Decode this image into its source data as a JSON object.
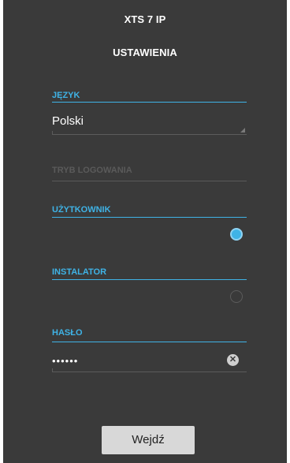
{
  "header": {
    "app_title": "XTS 7 IP",
    "page_title": "USTAWIENIA"
  },
  "language": {
    "label": "JĘZYK",
    "value": "Polski"
  },
  "login_mode": {
    "label": "TRYB LOGOWANIA"
  },
  "options": [
    {
      "label": "UŻYTKOWNIK",
      "selected": true
    },
    {
      "label": "INSTALATOR",
      "selected": false
    }
  ],
  "password": {
    "label": "HASŁO",
    "value": "••••••"
  },
  "submit": {
    "label": "Wejdź"
  },
  "colors": {
    "accent": "#3fb3e6",
    "background": "#3a3a3a"
  },
  "icons": {
    "clear": "clear-icon",
    "dropdown_corner": "dropdown-corner-icon"
  }
}
